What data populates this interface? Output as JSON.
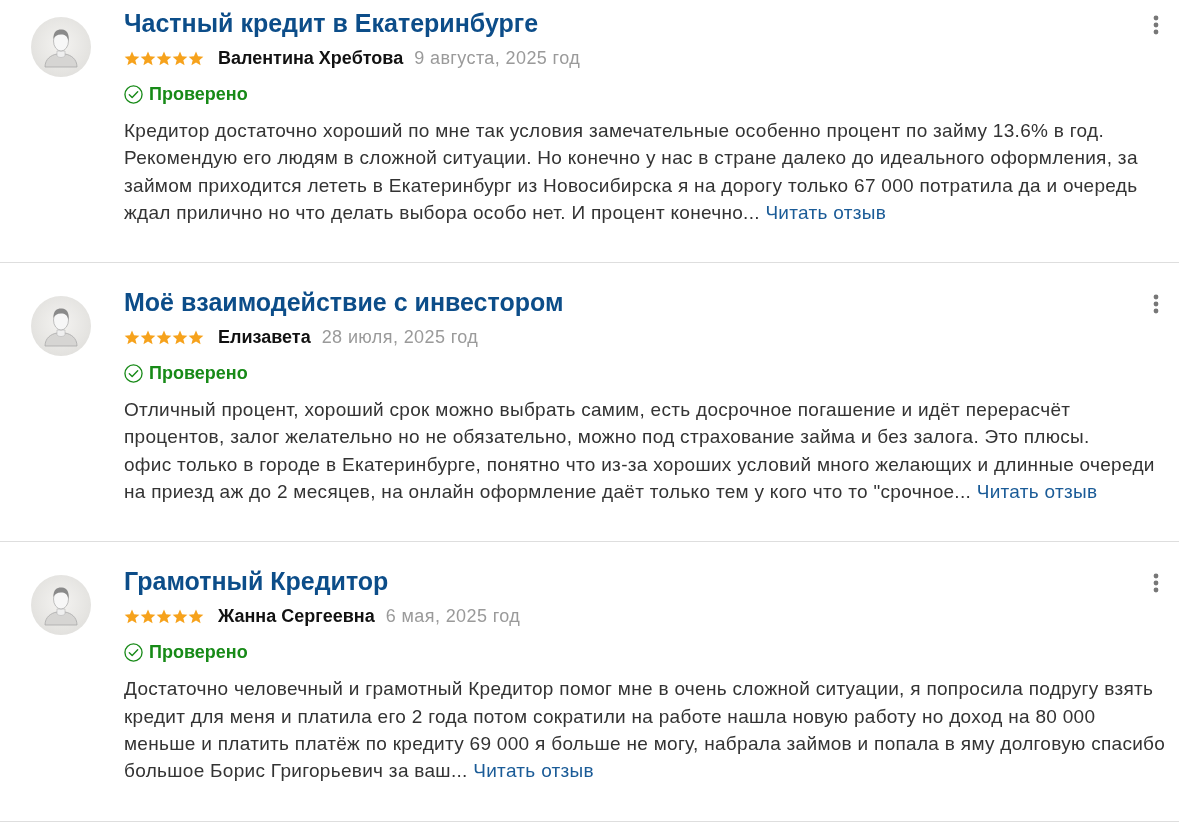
{
  "reviews": [
    {
      "title": "Частный кредит в Екатеринбурге",
      "stars": 5,
      "author": "Валентина Хребтова",
      "date": "9 августа, 2025 год",
      "verified": true,
      "verified_label": "Проверено",
      "text": "Кредитор достаточно хороший по мне так условия замечательные особенно процент по займу 13.6% в год. Рекомендую его людям в сложной ситуации. Но конечно у нас в стране далеко до идеального оформления, за займом приходится лететь в Екатеринбург из Новосибирска я на дорогу только 67 000 потратила да и очередь ждал прилично но что делать выбора особо нет. И процент конечно...",
      "more_link": "Читать отзыв"
    },
    {
      "title": "Моё взаимодействие с инвестором",
      "stars": 5,
      "author": "Елизавета",
      "date": "28 июля, 2025 год",
      "verified": true,
      "verified_label": "Проверено",
      "text": "Отличный процент, хороший срок можно выбрать самим, есть досрочное погашение и идёт перерасчёт процентов, залог желательно но не обязательно, можно под страхование займа и без залога. Это плюсы.\nофис только в городе в Екатеринбурге, понятно что из-за хороших условий много желающих и длинные очереди на приезд аж до 2 месяцев, на онлайн оформление даёт только тем у кого что то \"срочное...",
      "more_link": "Читать отзыв"
    },
    {
      "title": "Грамотный Кредитор",
      "stars": 5,
      "author": "Жанна Сергеевна",
      "date": "6 мая, 2025 год",
      "verified": true,
      "verified_label": "Проверено",
      "text": "Достаточно человечный и грамотный Кредитор помог мне в очень сложной ситуации, я попросила подругу взять кредит для меня и платила его 2 года потом сократили на работе нашла новую работу но доход на 80 000 меньше и платить платёж по кредиту 69 000 я больше не могу, набрала займов и попала в яму долговую спасибо большое Борис Григорьевич за ваш...",
      "more_link": "Читать отзыв"
    }
  ]
}
